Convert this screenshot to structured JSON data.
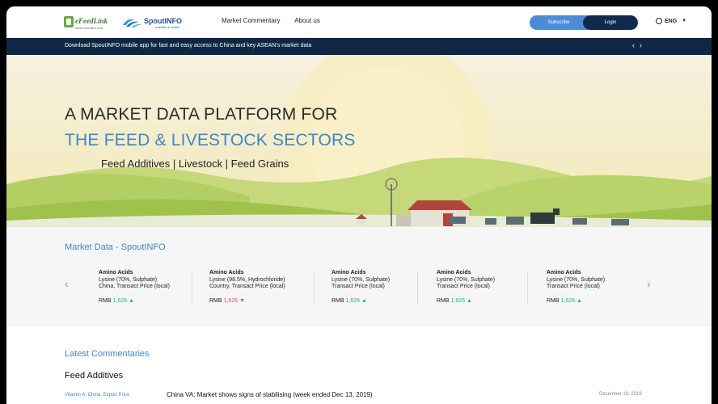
{
  "header": {
    "efeed_logo_name": "eFeedLink",
    "efeed_logo_url": "www.efeedlink.com",
    "spout_logo_name": "SpoutINFO",
    "spout_logo_tagline": "markets in action",
    "nav": [
      "Market Commentary",
      "About us"
    ],
    "subscribe_label": "Subscribe",
    "login_label": "Login",
    "language_label": "ENG"
  },
  "announcement": {
    "text": "Download SpoutINFO mobile app for fast and easy access to China and key ASEAN's market data",
    "prev": "‹",
    "next": "›"
  },
  "hero": {
    "line1": "A MARKET DATA PLATFORM FOR",
    "line2": "THE FEED & LIVESTOCK SECTORS",
    "line3": "Feed Additives | Livestock | Feed Grains"
  },
  "market": {
    "title": "Market Data - SpoutINFO",
    "cards": [
      {
        "category": "Amino Acids",
        "line1": "Lysine (70%, Sulphate)",
        "line2": "China, Transact Price (local)",
        "currency": "RMB",
        "value": "1,626",
        "trend": "▲"
      },
      {
        "category": "Amino Acids",
        "line1": "Lysine (98.5%, Hydrochloride)",
        "line2": "Country, Transact Price (local)",
        "currency": "RMB",
        "value": "1,626",
        "trend": "▼"
      },
      {
        "category": "Amino Acids",
        "line1": "Lysine (70%, Sulphate)",
        "line2": "Transact Price (local)",
        "currency": "RMB",
        "value": "1,626",
        "trend": "▲"
      },
      {
        "category": "Amino Acids",
        "line1": "Lysine (70%, Sulphate)",
        "line2": "Transact Price (local)",
        "currency": "RMB",
        "value": "1,626",
        "trend": "▲"
      },
      {
        "category": "Amino Acids",
        "line1": "Lysine (70%, Sulphate)",
        "line2": "Transact Price (local)",
        "currency": "RMB",
        "value": "1,626",
        "trend": "▲"
      }
    ],
    "prev": "‹",
    "next": "›"
  },
  "commentaries": {
    "title": "Latest Commentaries",
    "section": "Feed Additives",
    "rows": [
      {
        "tag": "Vitamin A, China, Export Price",
        "title": "China VA: Market shows signs of stabilising (week ended Dec 13, 2019)",
        "date": "December 19, 2019"
      }
    ]
  },
  "colors": {
    "accent_blue": "#3f86c9",
    "navy": "#0f2744",
    "up": "#2eb07e",
    "down": "#d9534f"
  }
}
